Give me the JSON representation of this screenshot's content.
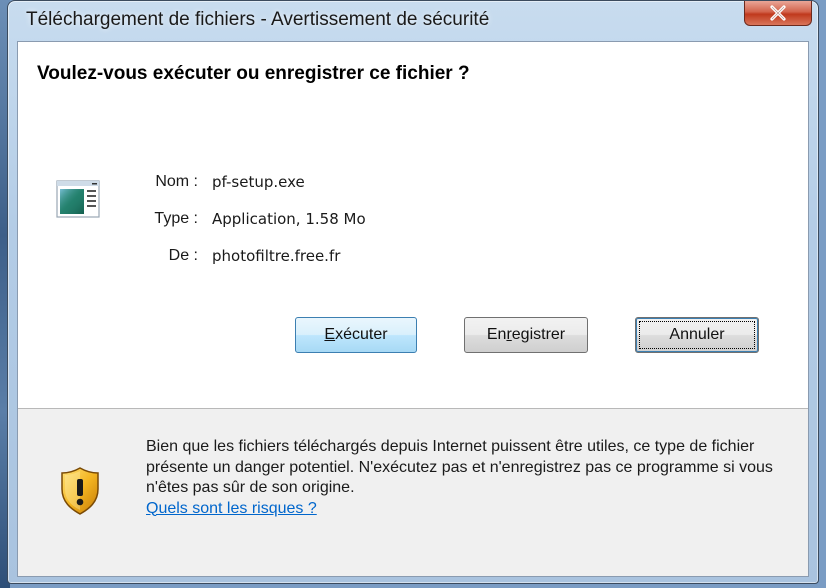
{
  "window": {
    "title": "Téléchargement de fichiers - Avertissement de sécurité"
  },
  "dialog": {
    "question": "Voulez-vous exécuter ou enregistrer ce fichier ?",
    "file": {
      "name_label": "Nom :",
      "name_value": "pf-setup.exe",
      "type_label": "Type :",
      "type_value": "Application, 1.58 Mo",
      "from_label": "De :",
      "from_value": "photofiltre.free.fr",
      "icon": "application-icon"
    },
    "buttons": {
      "run_prefix": "",
      "run_accel": "E",
      "run_rest": "xécuter",
      "save_prefix": "En",
      "save_accel": "r",
      "save_rest": "egistrer",
      "cancel": "Annuler"
    },
    "warning": {
      "icon": "shield-warning-icon",
      "text": "Bien que les fichiers téléchargés depuis Internet puissent être utiles, ce type de fichier présente un danger potentiel. N'exécutez pas et n'enregistrez pas ce programme si vous n'êtes pas sûr de son origine.",
      "link": "Quels sont les risques ?"
    }
  },
  "colors": {
    "link": "#0066cc",
    "close_button": "#c0391d",
    "default_button": "#bee6fd"
  }
}
